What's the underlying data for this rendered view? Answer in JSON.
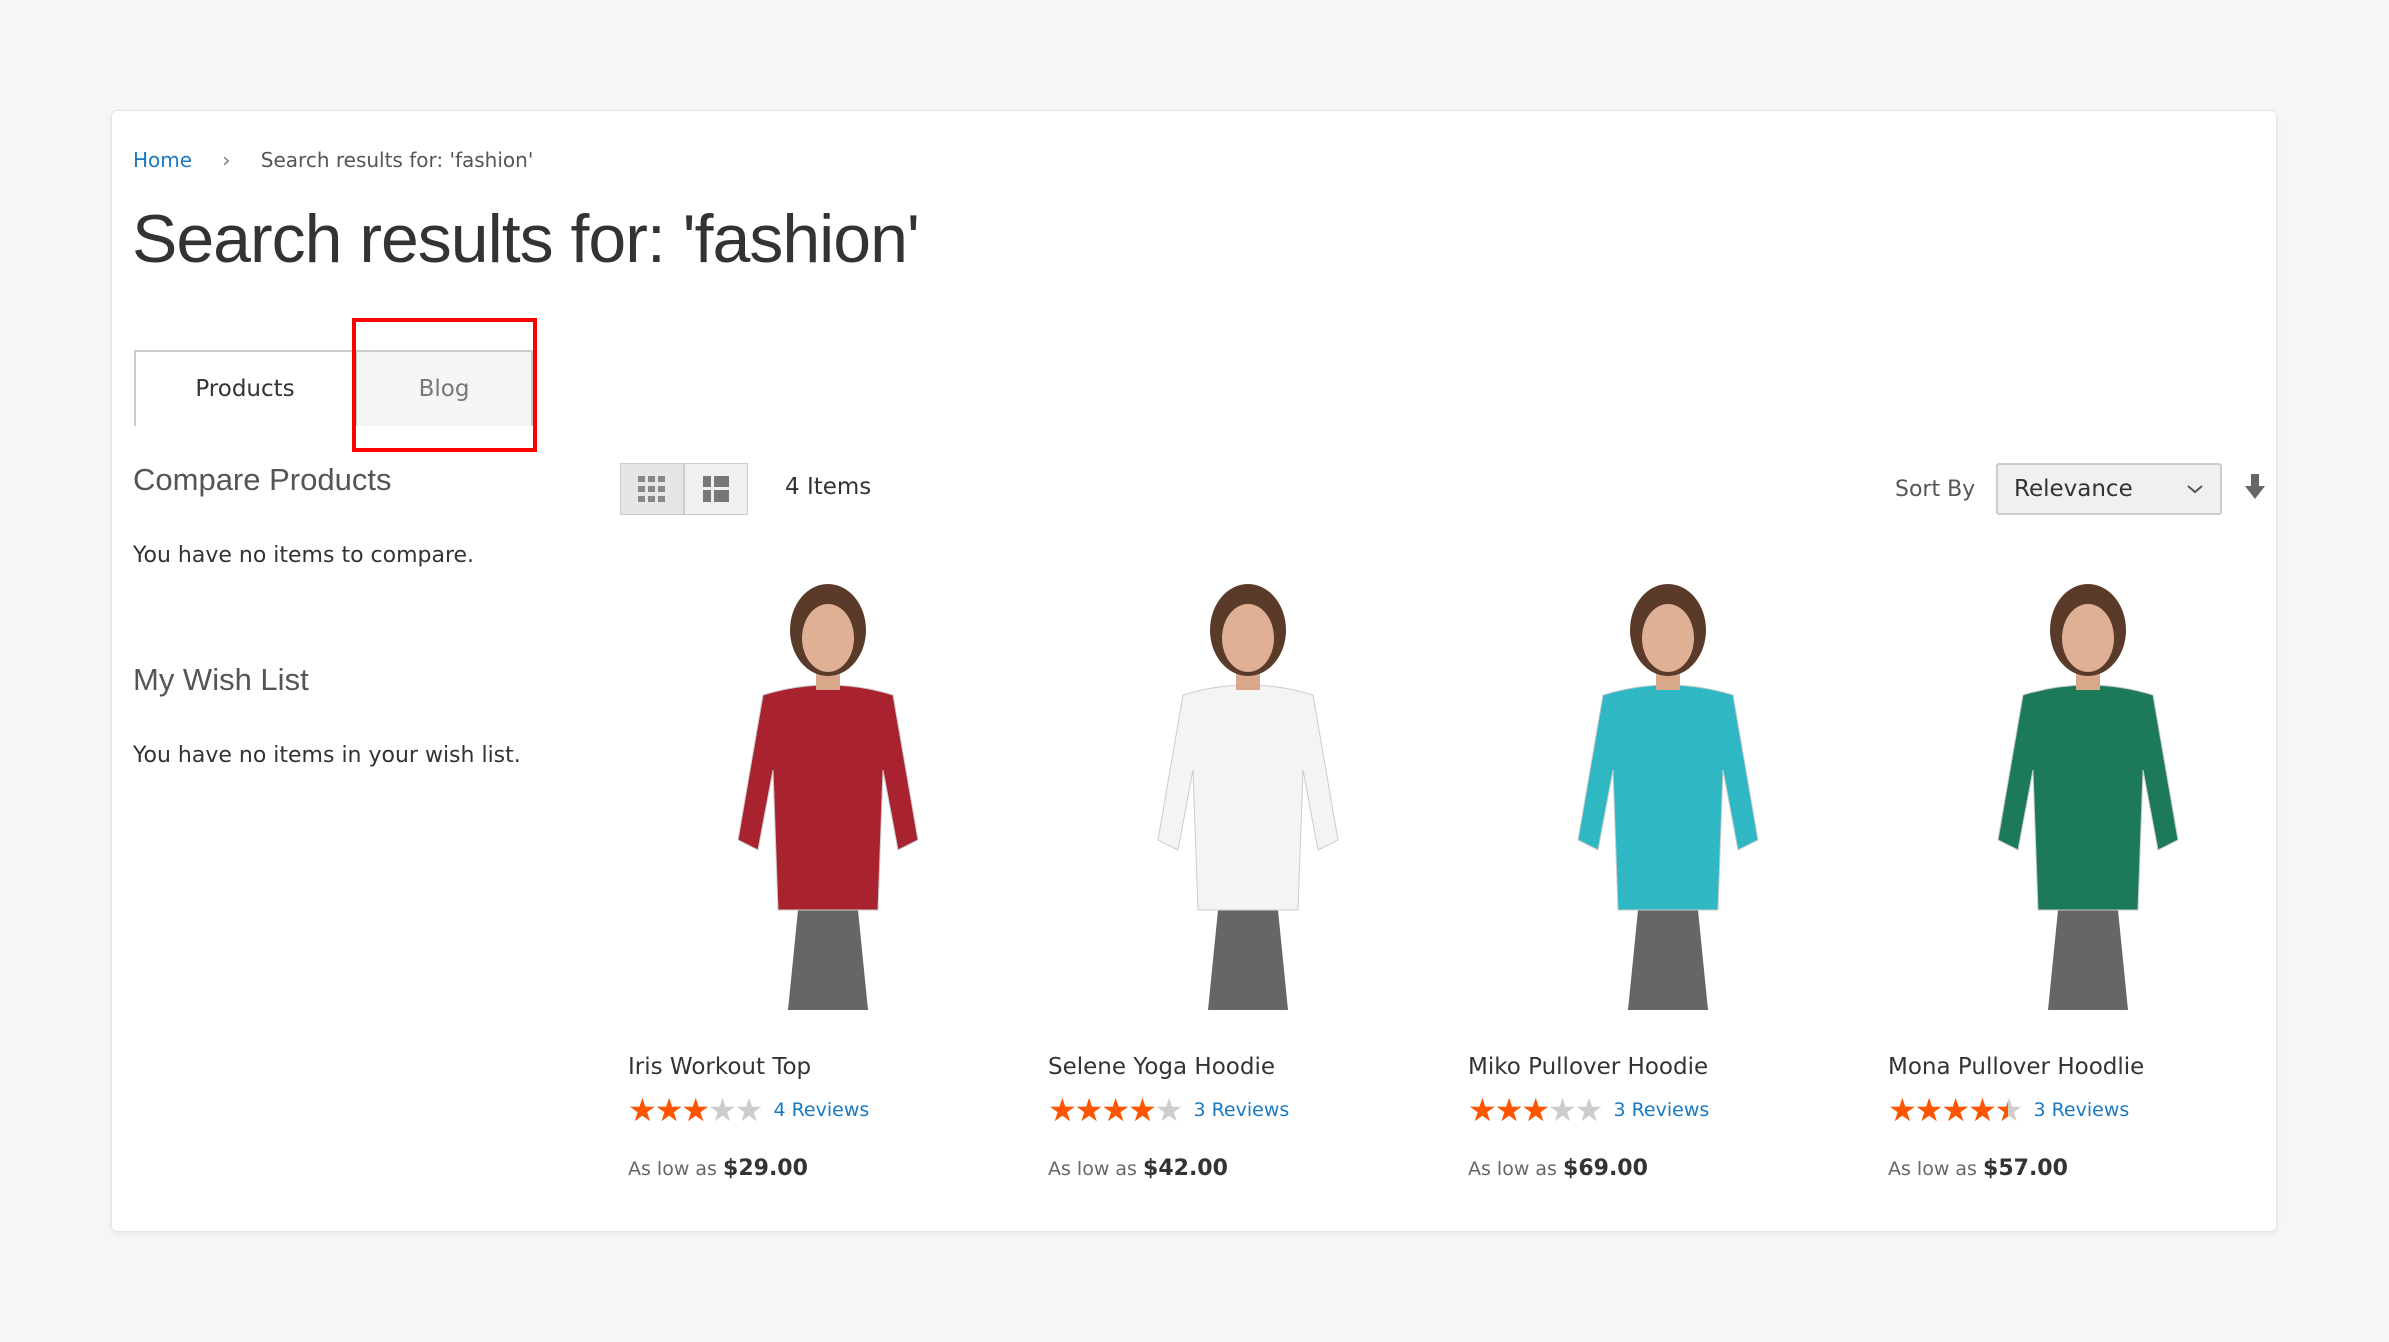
{
  "breadcrumb": {
    "home": "Home",
    "separator": "›",
    "current": "Search results for: 'fashion'"
  },
  "page_title": "Search results for: 'fashion'",
  "tabs": [
    {
      "label": "Products",
      "active": true
    },
    {
      "label": "Blog",
      "active": false,
      "highlighted": true
    }
  ],
  "sidebar": {
    "compare_title": "Compare Products",
    "compare_text": "You have no items to compare.",
    "wishlist_title": "My Wish List",
    "wishlist_text": "You have no items in your wish list."
  },
  "toolbar": {
    "view_modes": [
      "grid-icon",
      "list-icon"
    ],
    "count": "4 Items",
    "sort_label": "Sort By",
    "sort_value": "Relevance",
    "sort_direction_icon": "arrow-down-icon"
  },
  "colors": {
    "link": "#1979c3",
    "star": "#ff5501",
    "highlight": "#ff0000"
  },
  "products": [
    {
      "name": "Iris Workout Top",
      "rating": 3,
      "reviews": "4 Reviews",
      "price_prefix": "As low as",
      "price": "$29.00",
      "shirt": "#a8232f"
    },
    {
      "name": "Selene Yoga Hoodie",
      "rating": 4,
      "reviews": "3 Reviews",
      "price_prefix": "As low as",
      "price": "$42.00",
      "shirt": "#f4f4f4"
    },
    {
      "name": "Miko Pullover Hoodie",
      "rating": 3,
      "reviews": "3 Reviews",
      "price_prefix": "As low as",
      "price": "$69.00",
      "shirt": "#2fb8c4"
    },
    {
      "name": "Mona Pullover Hoodlie",
      "rating": 4.5,
      "reviews": "3 Reviews",
      "price_prefix": "As low as",
      "price": "$57.00",
      "shirt": "#1d7a58"
    }
  ]
}
